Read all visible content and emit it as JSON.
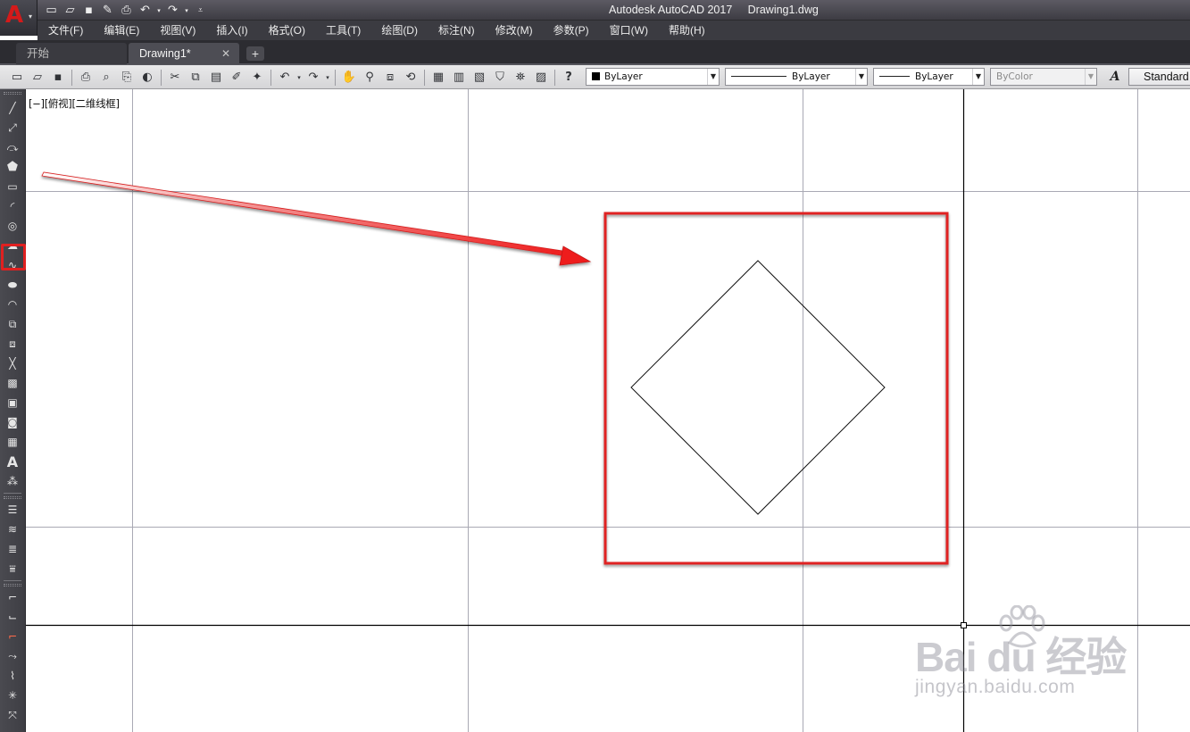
{
  "window": {
    "title": "Autodesk AutoCAD 2017     Drawing1.dwg",
    "app_letter": "A"
  },
  "quick_access": {
    "icons": [
      "new-icon",
      "open-icon",
      "save-icon",
      "save-as-icon",
      "print-icon",
      "undo-icon",
      "redo-icon",
      "customize-icon"
    ]
  },
  "menu": {
    "items": [
      "文件(F)",
      "编辑(E)",
      "视图(V)",
      "插入(I)",
      "格式(O)",
      "工具(T)",
      "绘图(D)",
      "标注(N)",
      "修改(M)",
      "参数(P)",
      "窗口(W)",
      "帮助(H)"
    ]
  },
  "tabs": {
    "start_label": "开始",
    "drawing_label": "Drawing1*",
    "close_glyph": "✕",
    "add_glyph": "+"
  },
  "toolbar": {
    "color_value": "ByLayer",
    "linetype_value": "ByLayer",
    "lineweight_value": "ByLayer",
    "plotstyle_value": "ByColor",
    "text_style_value": "Standard"
  },
  "viewport": {
    "label": "[−][俯视][二维线框]"
  },
  "annotation": {
    "highlight_color": "#e02020",
    "tool_highlighted": "polygon-tool"
  },
  "watermark": {
    "logo": "Bai  du 经验",
    "url": "jingyan.baidu.com"
  },
  "colors": {
    "grid_line": "#a9a9b4",
    "axis_line": "#000000",
    "drawing_line": "#111111",
    "accent_red": "#e02020"
  }
}
